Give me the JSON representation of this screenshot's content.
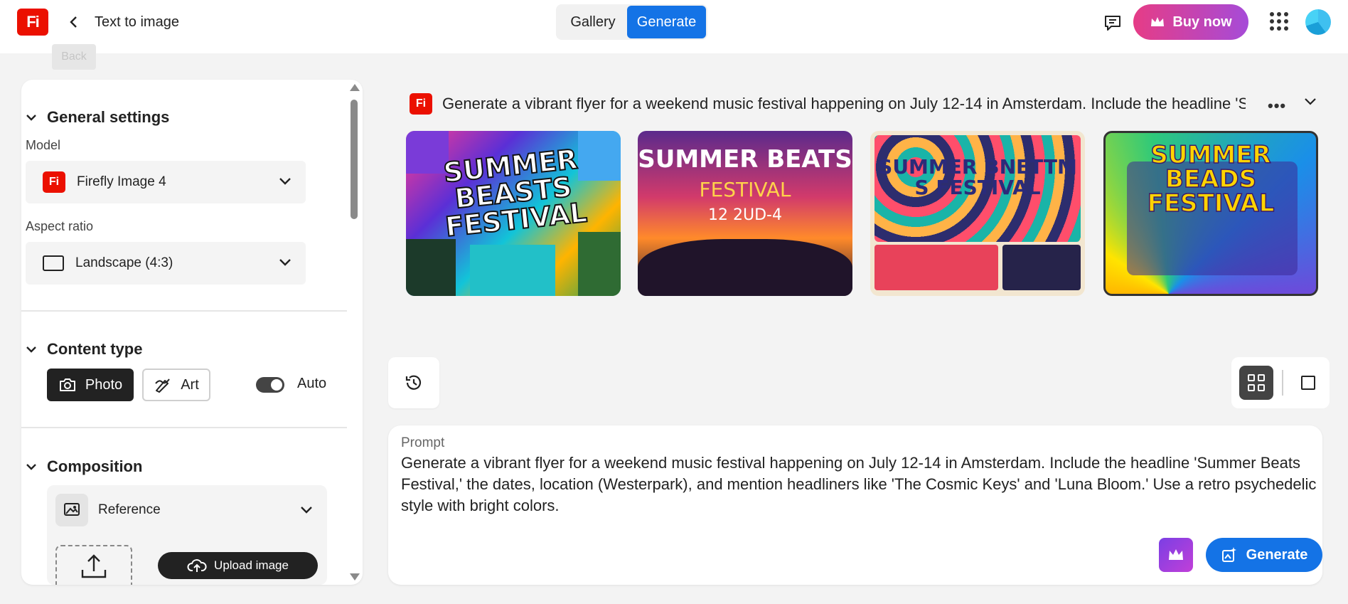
{
  "app": {
    "logo_text": "Fi",
    "page_title": "Text to image",
    "back_tooltip": "Back"
  },
  "header": {
    "tabs": [
      {
        "label": "Gallery",
        "active": false
      },
      {
        "label": "Generate",
        "active": true
      }
    ],
    "buy_label": "Buy now",
    "brand_gradient": [
      "#e63c86",
      "#a64bd8"
    ]
  },
  "settings": {
    "general": {
      "title": "General settings",
      "model_label": "Model",
      "model_icon_text": "Fi",
      "model_value": "Firefly Image 4",
      "aspect_label": "Aspect ratio",
      "aspect_value": "Landscape (4:3)"
    },
    "content_type": {
      "title": "Content type",
      "photo_label": "Photo",
      "art_label": "Art",
      "auto_label": "Auto",
      "auto_enabled": true
    },
    "composition": {
      "title": "Composition",
      "reference_label": "Reference",
      "upload_label": "Upload image"
    }
  },
  "results": {
    "prompt_icon_text": "Fi",
    "prompt_summary": "Generate a vibrant flyer for a weekend music festival happening on July 12-14 in Amsterdam. Include the headline 'Summer Beats Festival,' the dates, location (Westerpark), and mention headliners like 'The Cosmic Keys' and 'Luna Bloom.' Use a retro psychedelic style with bright colors.",
    "thumbnails": [
      {
        "title": "SUMMER BEASTS FESTIVAL"
      },
      {
        "title": "SUMMER BEATS",
        "subtitle": "FESTIVAL",
        "dates": "12 2UD-4"
      },
      {
        "title": "SUMMER BNETTM S FESTIVAL"
      },
      {
        "title": "SUMMER BEADS FESTIVAL"
      }
    ]
  },
  "prompt": {
    "label": "Prompt",
    "text": "Generate a vibrant flyer for a weekend music festival happening on July 12-14 in Amsterdam. Include the headline 'Summer Beats Festival,' the dates, location (Westerpark), and mention headliners like 'The Cosmic Keys' and 'Luna Bloom.' Use a retro psychedelic style with bright colors.",
    "generate_label": "Generate"
  },
  "colors": {
    "accent": "#1473e6",
    "brand_red": "#eb1000"
  }
}
